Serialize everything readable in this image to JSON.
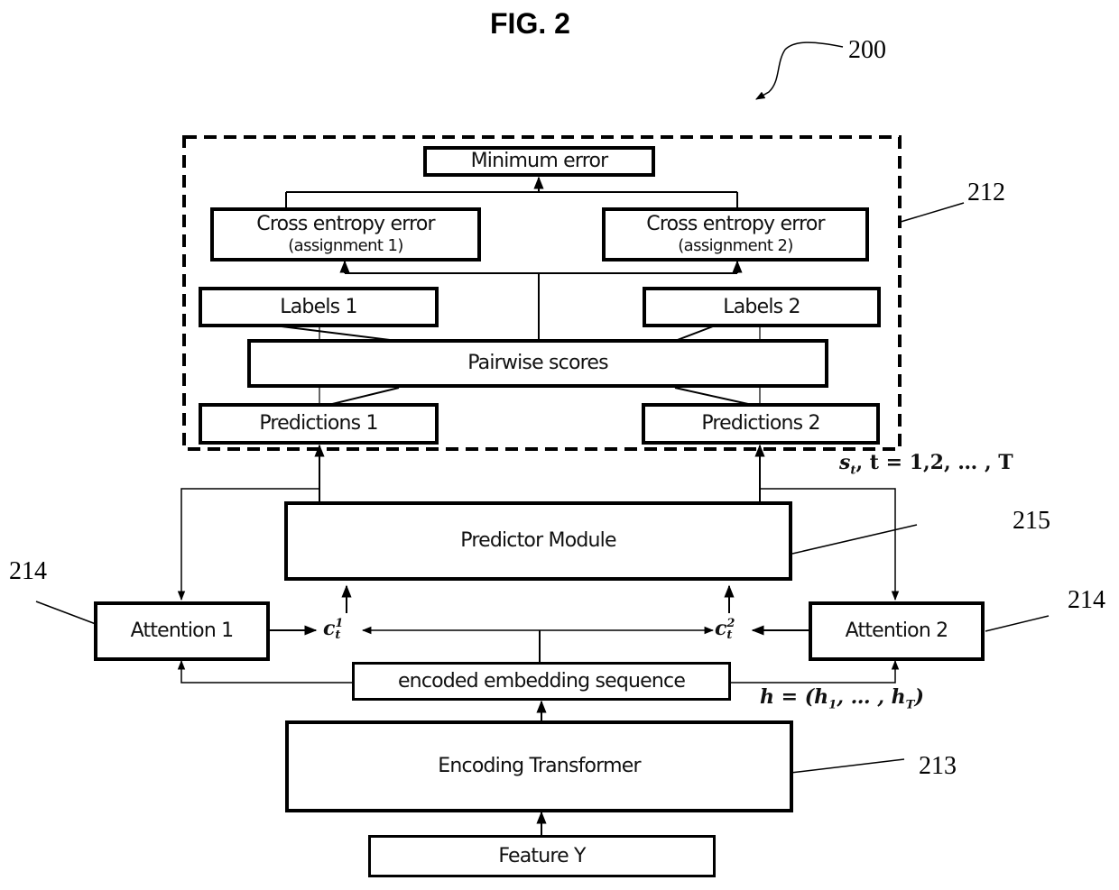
{
  "figure": {
    "title": "FIG. 2",
    "system_ref": "200"
  },
  "region_212": {
    "ref": "212",
    "boxes": {
      "minimum_error": "Minimum error",
      "cross_entropy_1": {
        "title": "Cross entropy error",
        "subtitle": "(assignment 1)"
      },
      "cross_entropy_2": {
        "title": "Cross entropy error",
        "subtitle": "(assignment 2)"
      },
      "labels_1": "Labels 1",
      "labels_2": "Labels 2",
      "pairwise_scores": "Pairwise scores",
      "predictions_1": "Predictions 1",
      "predictions_2": "Predictions 2"
    }
  },
  "predictor": {
    "label": "Predictor Module",
    "ref": "215"
  },
  "attention_1": {
    "label": "Attention 1",
    "ref": "214"
  },
  "attention_2": {
    "label": "Attention 2",
    "ref": "214"
  },
  "encoded_sequence": {
    "label": "encoded embedding sequence"
  },
  "encoder": {
    "label": "Encoding Transformer",
    "ref": "213"
  },
  "feature": {
    "label": "Feature Y"
  },
  "math_labels": {
    "s_t": "s",
    "s_t_sub": "t",
    "s_t_range": ", t = 1,2, … , T",
    "c1_base": "c",
    "c1_sub": "t",
    "c1_sup": "1",
    "c2_base": "c",
    "c2_sub": "t",
    "c2_sup": "2",
    "h_expr": "h = (h",
    "h_sub1": "1",
    "h_mid": ", … , h",
    "h_subT": "T",
    "h_close": ")"
  }
}
